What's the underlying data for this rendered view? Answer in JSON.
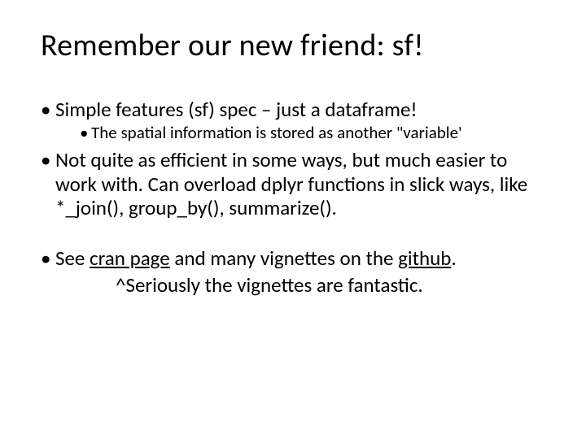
{
  "title": "Remember our new friend: sf!",
  "bullets": {
    "b1": "Simple features (sf) spec – just a dataframe!",
    "b1_sub": "The spatial information is stored as another \"variable'",
    "b2": "Not quite as efficient in some ways, but much easier to work with. Can overload dplyr functions in slick ways, like *_join(), group_by(), summarize().",
    "b3_pre": "See ",
    "b3_link1": "cran page",
    "b3_mid": " and many vignettes on the ",
    "b3_link2": "github",
    "b3_post": ".",
    "b3_tail": "^Seriously the vignettes are fantastic."
  }
}
